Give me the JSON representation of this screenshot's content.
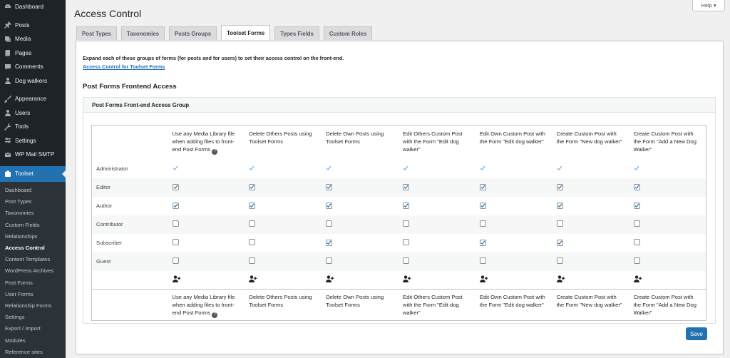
{
  "sidebar": {
    "top_items": [
      {
        "label": "Dashboard",
        "icon": "dashboard-icon"
      },
      {
        "label": "Posts",
        "icon": "pin-icon"
      },
      {
        "label": "Media",
        "icon": "media-icon"
      },
      {
        "label": "Pages",
        "icon": "pages-icon"
      },
      {
        "label": "Comments",
        "icon": "comments-icon"
      },
      {
        "label": "Dog walkers",
        "icon": "user-icon"
      },
      {
        "label": "Appearance",
        "icon": "brush-icon"
      },
      {
        "label": "Users",
        "icon": "users-icon"
      },
      {
        "label": "Tools",
        "icon": "wrench-icon"
      },
      {
        "label": "Settings",
        "icon": "settings-icon"
      },
      {
        "label": "WP Mail SMTP",
        "icon": "mail-icon"
      }
    ],
    "active_item": {
      "label": "Toolset",
      "icon": "toolset-icon"
    },
    "submenu": [
      "Dashboard",
      "Post Types",
      "Taxonomies",
      "Custom Fields",
      "Relationships",
      "Access Control",
      "Content Templates",
      "WordPress Archives",
      "Post Forms",
      "User Forms",
      "Relationship Forms",
      "Settings",
      "Export / Import",
      "Modules",
      "Reference sites"
    ],
    "current_submenu": "Access Control"
  },
  "header": {
    "title": "Access Control",
    "help_label": "Help ▾"
  },
  "tabs": [
    "Post Types",
    "Taxonomies",
    "Posts Groups",
    "Toolset Forms",
    "Types Fields",
    "Custom Roles"
  ],
  "active_tab": "Toolset Forms",
  "intro": {
    "text": "Expand each of these groups of forms (for posts and for users) to set their access control on the front-end.",
    "link": "Access Control for Toolset Forms"
  },
  "section_title": "Post Forms Frontend Access",
  "group_title": "Post Forms Front-end Access Group",
  "columns": [
    "Use any Media Library file when adding files to front-end Post Forms",
    "Delete Others Posts using Toolset Forms",
    "Delete Own Posts using Toolset Forms",
    "Edit Others Custom Post with the Form \"Edit dog walker\"",
    "Edit Own Custom Post with the Form \"Edit dog walker\"",
    "Create Custom Post with the Form \"New dog walker\"",
    "Create Custom Post with the Form \"Add a New Dog Walker\""
  ],
  "rows": [
    {
      "role": "Administrator",
      "type": "tick",
      "values": [
        true,
        true,
        true,
        true,
        true,
        true,
        true
      ]
    },
    {
      "role": "Editor",
      "type": "checkbox",
      "values": [
        true,
        true,
        true,
        true,
        true,
        true,
        true
      ]
    },
    {
      "role": "Author",
      "type": "checkbox",
      "values": [
        true,
        true,
        true,
        true,
        true,
        true,
        true
      ]
    },
    {
      "role": "Contributor",
      "type": "checkbox",
      "values": [
        false,
        false,
        false,
        false,
        false,
        false,
        false
      ]
    },
    {
      "role": "Subscriber",
      "type": "checkbox",
      "values": [
        false,
        false,
        true,
        false,
        true,
        true,
        false
      ]
    },
    {
      "role": "Guest",
      "type": "checkbox",
      "values": [
        false,
        false,
        false,
        false,
        false,
        false,
        false
      ]
    }
  ],
  "help_glyph": "?",
  "save_label": "Save",
  "colors": {
    "accent": "#2271b1",
    "sidebar_bg": "#1d2327"
  }
}
